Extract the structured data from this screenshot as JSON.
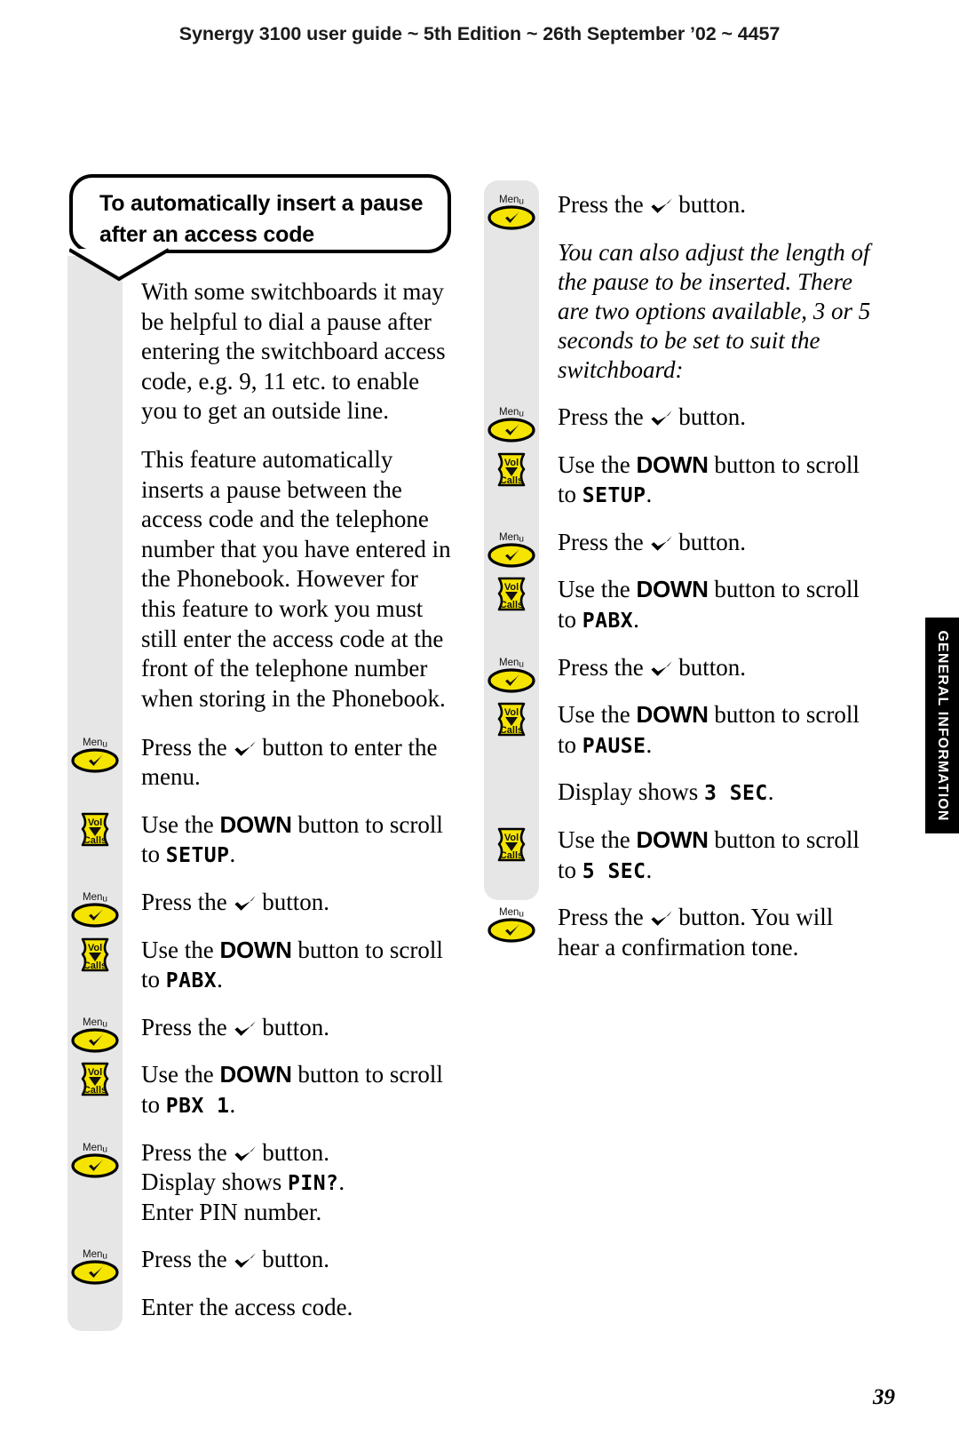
{
  "header": {
    "running_head": "Synergy 3100 user guide ~ 5th Edition ~ 26th September ’02 ~ 4457"
  },
  "thumb_tab": {
    "label": "GENERAL INFORMATION",
    "background": "#000000",
    "text_color": "#ffffff"
  },
  "callout": {
    "title": "To automatically insert a pause after an access code"
  },
  "keys": {
    "menu": {
      "label": "Menu",
      "icon": "tick-check-icon",
      "color": "#f5e400"
    },
    "volcalls": {
      "label_top": "Vol",
      "label_bottom": "Calls",
      "icon": "down-triangle-icon",
      "color": "#f5e400"
    }
  },
  "left_column": {
    "paragraphs": [
      "With some switchboards it may be helpful to dial a pause after entering the switchboard access code, e.g. 9, 11 etc. to enable you to get an outside line.",
      "This feature automatically inserts a pause between the access code and the telephone number that you have entered in the Phonebook. However for this feature to work you must still enter the access code at the front of the telephone number when storing in the Phonebook."
    ],
    "steps": [
      {
        "key": "menu",
        "parts": [
          {
            "t": "Press the ",
            "s": "plain"
          },
          {
            "t": "tick",
            "s": "glyph"
          },
          {
            "t": " button to enter the menu.",
            "s": "plain"
          }
        ]
      },
      {
        "key": "volcalls",
        "parts": [
          {
            "t": "Use the ",
            "s": "plain"
          },
          {
            "t": "DOWN",
            "s": "bold"
          },
          {
            "t": " button to scroll to ",
            "s": "plain"
          },
          {
            "t": "SETUP",
            "s": "lcd"
          },
          {
            "t": ".",
            "s": "plain"
          }
        ]
      },
      {
        "key": "menu",
        "parts": [
          {
            "t": "Press the ",
            "s": "plain"
          },
          {
            "t": "tick",
            "s": "glyph"
          },
          {
            "t": " button.",
            "s": "plain"
          }
        ]
      },
      {
        "key": "volcalls",
        "parts": [
          {
            "t": "Use the ",
            "s": "plain"
          },
          {
            "t": "DOWN",
            "s": "bold"
          },
          {
            "t": " button to scroll to ",
            "s": "plain"
          },
          {
            "t": "PABX",
            "s": "lcd"
          },
          {
            "t": ".",
            "s": "plain"
          }
        ]
      },
      {
        "key": "menu",
        "parts": [
          {
            "t": "Press the ",
            "s": "plain"
          },
          {
            "t": "tick",
            "s": "glyph"
          },
          {
            "t": " button.",
            "s": "plain"
          }
        ]
      },
      {
        "key": "volcalls",
        "parts": [
          {
            "t": "Use the ",
            "s": "plain"
          },
          {
            "t": "DOWN",
            "s": "bold"
          },
          {
            "t": " button to scroll to ",
            "s": "plain"
          },
          {
            "t": "PBX 1",
            "s": "lcd"
          },
          {
            "t": ".",
            "s": "plain"
          }
        ]
      },
      {
        "key": "menu",
        "parts": [
          {
            "t": "Press the ",
            "s": "plain"
          },
          {
            "t": "tick",
            "s": "glyph"
          },
          {
            "t": " button.",
            "s": "plain"
          },
          {
            "t": "br",
            "s": "break"
          },
          {
            "t": "Display shows ",
            "s": "plain"
          },
          {
            "t": "PIN?",
            "s": "lcd"
          },
          {
            "t": ".",
            "s": "plain"
          },
          {
            "t": "br",
            "s": "break"
          },
          {
            "t": "Enter PIN number.",
            "s": "plain"
          }
        ]
      },
      {
        "key": "menu",
        "parts": [
          {
            "t": "Press the ",
            "s": "plain"
          },
          {
            "t": "tick",
            "s": "glyph"
          },
          {
            "t": " button.",
            "s": "plain"
          }
        ]
      },
      {
        "key": "none",
        "parts": [
          {
            "t": "Enter the access code.",
            "s": "plain"
          }
        ]
      }
    ]
  },
  "right_column": {
    "steps": [
      {
        "key": "menu",
        "parts": [
          {
            "t": "Press the ",
            "s": "plain"
          },
          {
            "t": "tick",
            "s": "glyph"
          },
          {
            "t": " button.",
            "s": "plain"
          }
        ]
      },
      {
        "key": "none",
        "italic": true,
        "parts": [
          {
            "t": "You can also adjust the length of the pause to be inserted. There are two options available, 3 or 5 seconds to be set to suit the switchboard:",
            "s": "plain"
          }
        ]
      },
      {
        "key": "menu",
        "parts": [
          {
            "t": "Press the ",
            "s": "plain"
          },
          {
            "t": "tick",
            "s": "glyph"
          },
          {
            "t": " button.",
            "s": "plain"
          }
        ]
      },
      {
        "key": "volcalls",
        "parts": [
          {
            "t": "Use the ",
            "s": "plain"
          },
          {
            "t": "DOWN",
            "s": "bold"
          },
          {
            "t": " button to scroll to ",
            "s": "plain"
          },
          {
            "t": "SETUP",
            "s": "lcd"
          },
          {
            "t": ".",
            "s": "plain"
          }
        ]
      },
      {
        "key": "menu",
        "parts": [
          {
            "t": "Press the ",
            "s": "plain"
          },
          {
            "t": "tick",
            "s": "glyph"
          },
          {
            "t": " button.",
            "s": "plain"
          }
        ]
      },
      {
        "key": "volcalls",
        "parts": [
          {
            "t": "Use the ",
            "s": "plain"
          },
          {
            "t": "DOWN",
            "s": "bold"
          },
          {
            "t": " button to scroll to ",
            "s": "plain"
          },
          {
            "t": "PABX",
            "s": "lcd"
          },
          {
            "t": ".",
            "s": "plain"
          }
        ]
      },
      {
        "key": "menu",
        "parts": [
          {
            "t": "Press the ",
            "s": "plain"
          },
          {
            "t": "tick",
            "s": "glyph"
          },
          {
            "t": " button.",
            "s": "plain"
          }
        ]
      },
      {
        "key": "volcalls",
        "parts": [
          {
            "t": "Use the ",
            "s": "plain"
          },
          {
            "t": "DOWN",
            "s": "bold"
          },
          {
            "t": " button to scroll to ",
            "s": "plain"
          },
          {
            "t": "PAUSE",
            "s": "lcd"
          },
          {
            "t": ".",
            "s": "plain"
          }
        ]
      },
      {
        "key": "none",
        "parts": [
          {
            "t": "Display shows ",
            "s": "plain"
          },
          {
            "t": "3 SEC",
            "s": "lcd"
          },
          {
            "t": ".",
            "s": "plain"
          }
        ]
      },
      {
        "key": "volcalls",
        "parts": [
          {
            "t": "Use the ",
            "s": "plain"
          },
          {
            "t": "DOWN",
            "s": "bold"
          },
          {
            "t": " button to scroll to ",
            "s": "plain"
          },
          {
            "t": "5 SEC",
            "s": "lcd"
          },
          {
            "t": ".",
            "s": "plain"
          }
        ]
      },
      {
        "key": "menu",
        "parts": [
          {
            "t": "Press the ",
            "s": "plain"
          },
          {
            "t": "tick",
            "s": "glyph"
          },
          {
            "t": " button. You will hear a confirmation tone.",
            "s": "plain"
          }
        ]
      }
    ]
  },
  "folio": {
    "page_number": "39"
  }
}
